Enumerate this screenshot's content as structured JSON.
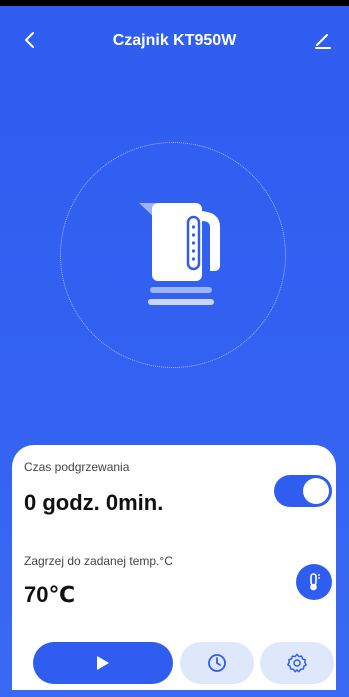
{
  "header": {
    "title": "Czajnik KT950W",
    "back_icon": "chevron-left-icon",
    "edit_icon": "pencil-icon"
  },
  "device": {
    "icon": "kettle-icon"
  },
  "heating": {
    "time_label": "Czas podgrzewania",
    "time_value": "0 godz. 0min.",
    "toggle_on": true
  },
  "temperature": {
    "label": "Zagrzej do zadanej temp.°C",
    "value": "70℃",
    "icon": "thermometer-icon"
  },
  "actions": {
    "play_icon": "play-icon",
    "timer_icon": "clock-icon",
    "settings_icon": "gear-icon"
  },
  "colors": {
    "primary": "#2f5df0",
    "secondary_button": "#dfe7fb",
    "card": "#ffffff"
  }
}
